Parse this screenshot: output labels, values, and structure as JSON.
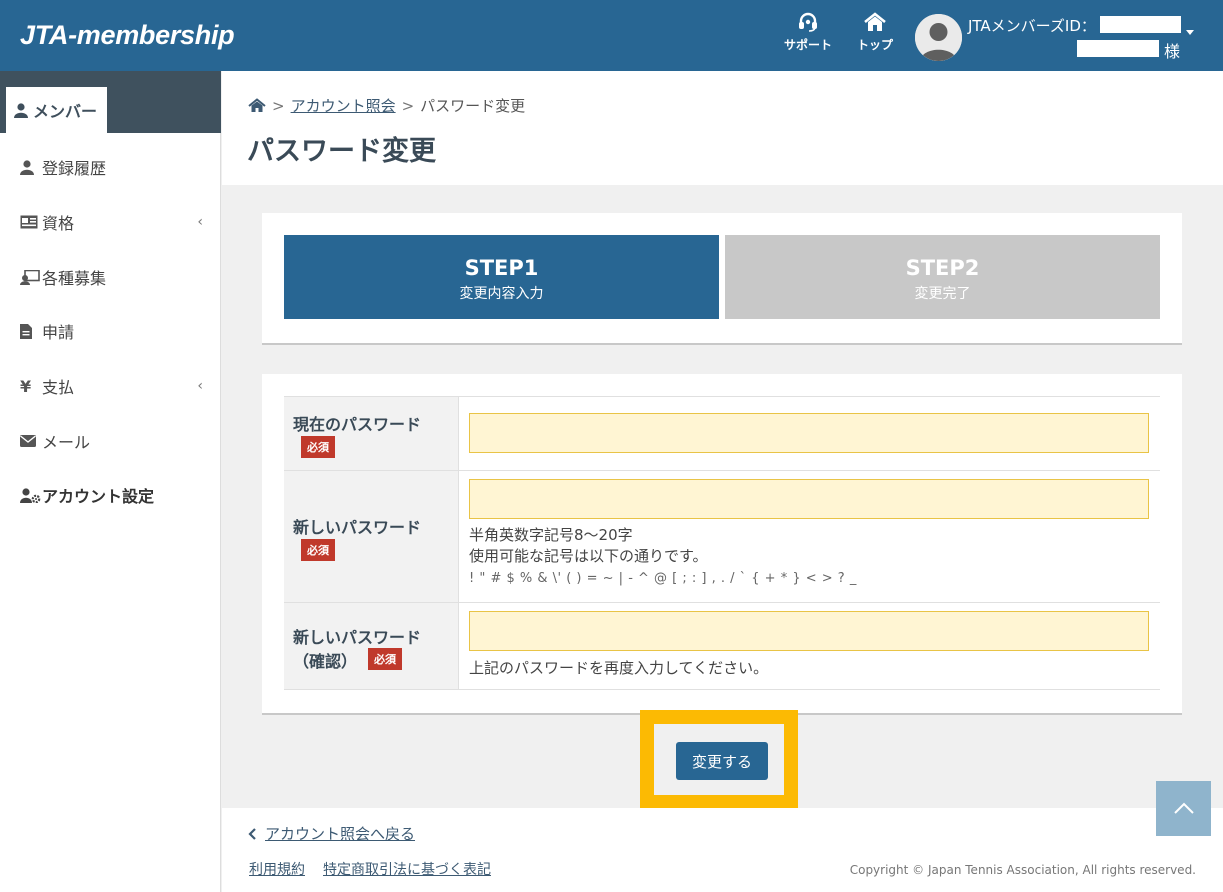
{
  "header": {
    "logo": "JTA-membership",
    "support_label": "サポート",
    "top_label": "トップ",
    "member_id_label": "JTAメンバーズID：",
    "honorific": "様"
  },
  "sidebar": {
    "active_tab": "メンバー",
    "items": [
      {
        "label": "登録履歴",
        "icon": "user-icon",
        "has_submenu": false
      },
      {
        "label": "資格",
        "icon": "id-card-icon",
        "has_submenu": true
      },
      {
        "label": "各種募集",
        "icon": "recruit-icon",
        "has_submenu": false
      },
      {
        "label": "申請",
        "icon": "document-icon",
        "has_submenu": false
      },
      {
        "label": "支払",
        "icon": "yen-icon",
        "has_submenu": true
      },
      {
        "label": "メール",
        "icon": "envelope-icon",
        "has_submenu": false
      },
      {
        "label": "アカウント設定",
        "icon": "user-gear-icon",
        "has_submenu": false
      }
    ],
    "chevron": "‹"
  },
  "breadcrumb": {
    "separator": ">",
    "parent": "アカウント照会",
    "current": "パスワード変更"
  },
  "page_title": "パスワード変更",
  "steps": [
    {
      "title": "STEP1",
      "subtitle": "変更内容入力",
      "active": true
    },
    {
      "title": "STEP2",
      "subtitle": "変更完了",
      "active": false
    }
  ],
  "form": {
    "required_badge": "必須",
    "current_password": {
      "label": "現在のパスワード",
      "value": ""
    },
    "new_password": {
      "label": "新しいパスワード",
      "value": "",
      "help1": "半角英数字記号8〜20字",
      "help2": "使用可能な記号は以下の通りです。",
      "symbols": "! \" # $ % & \\' ( ) = ~ | - ^ @ [ ; : ] , . / ` { + * } < > ? _"
    },
    "confirm_password": {
      "label_line1": "新しいパスワード",
      "label_line2": "（確認）",
      "value": "",
      "help": "上記のパスワードを再度入力してください。"
    }
  },
  "submit_label": "変更する",
  "footer": {
    "back_link": "アカウント照会へ戻る",
    "terms": "利用規約",
    "tokusho": "特定商取引法に基づく表記",
    "copyright": "Copyright © Japan Tennis Association, All rights reserved."
  },
  "colors": {
    "brand": "#286693",
    "step_inactive": "#c8c8c8",
    "input_bg": "#fff5d3",
    "required": "#c0392b",
    "highlight": "#fcba03"
  }
}
